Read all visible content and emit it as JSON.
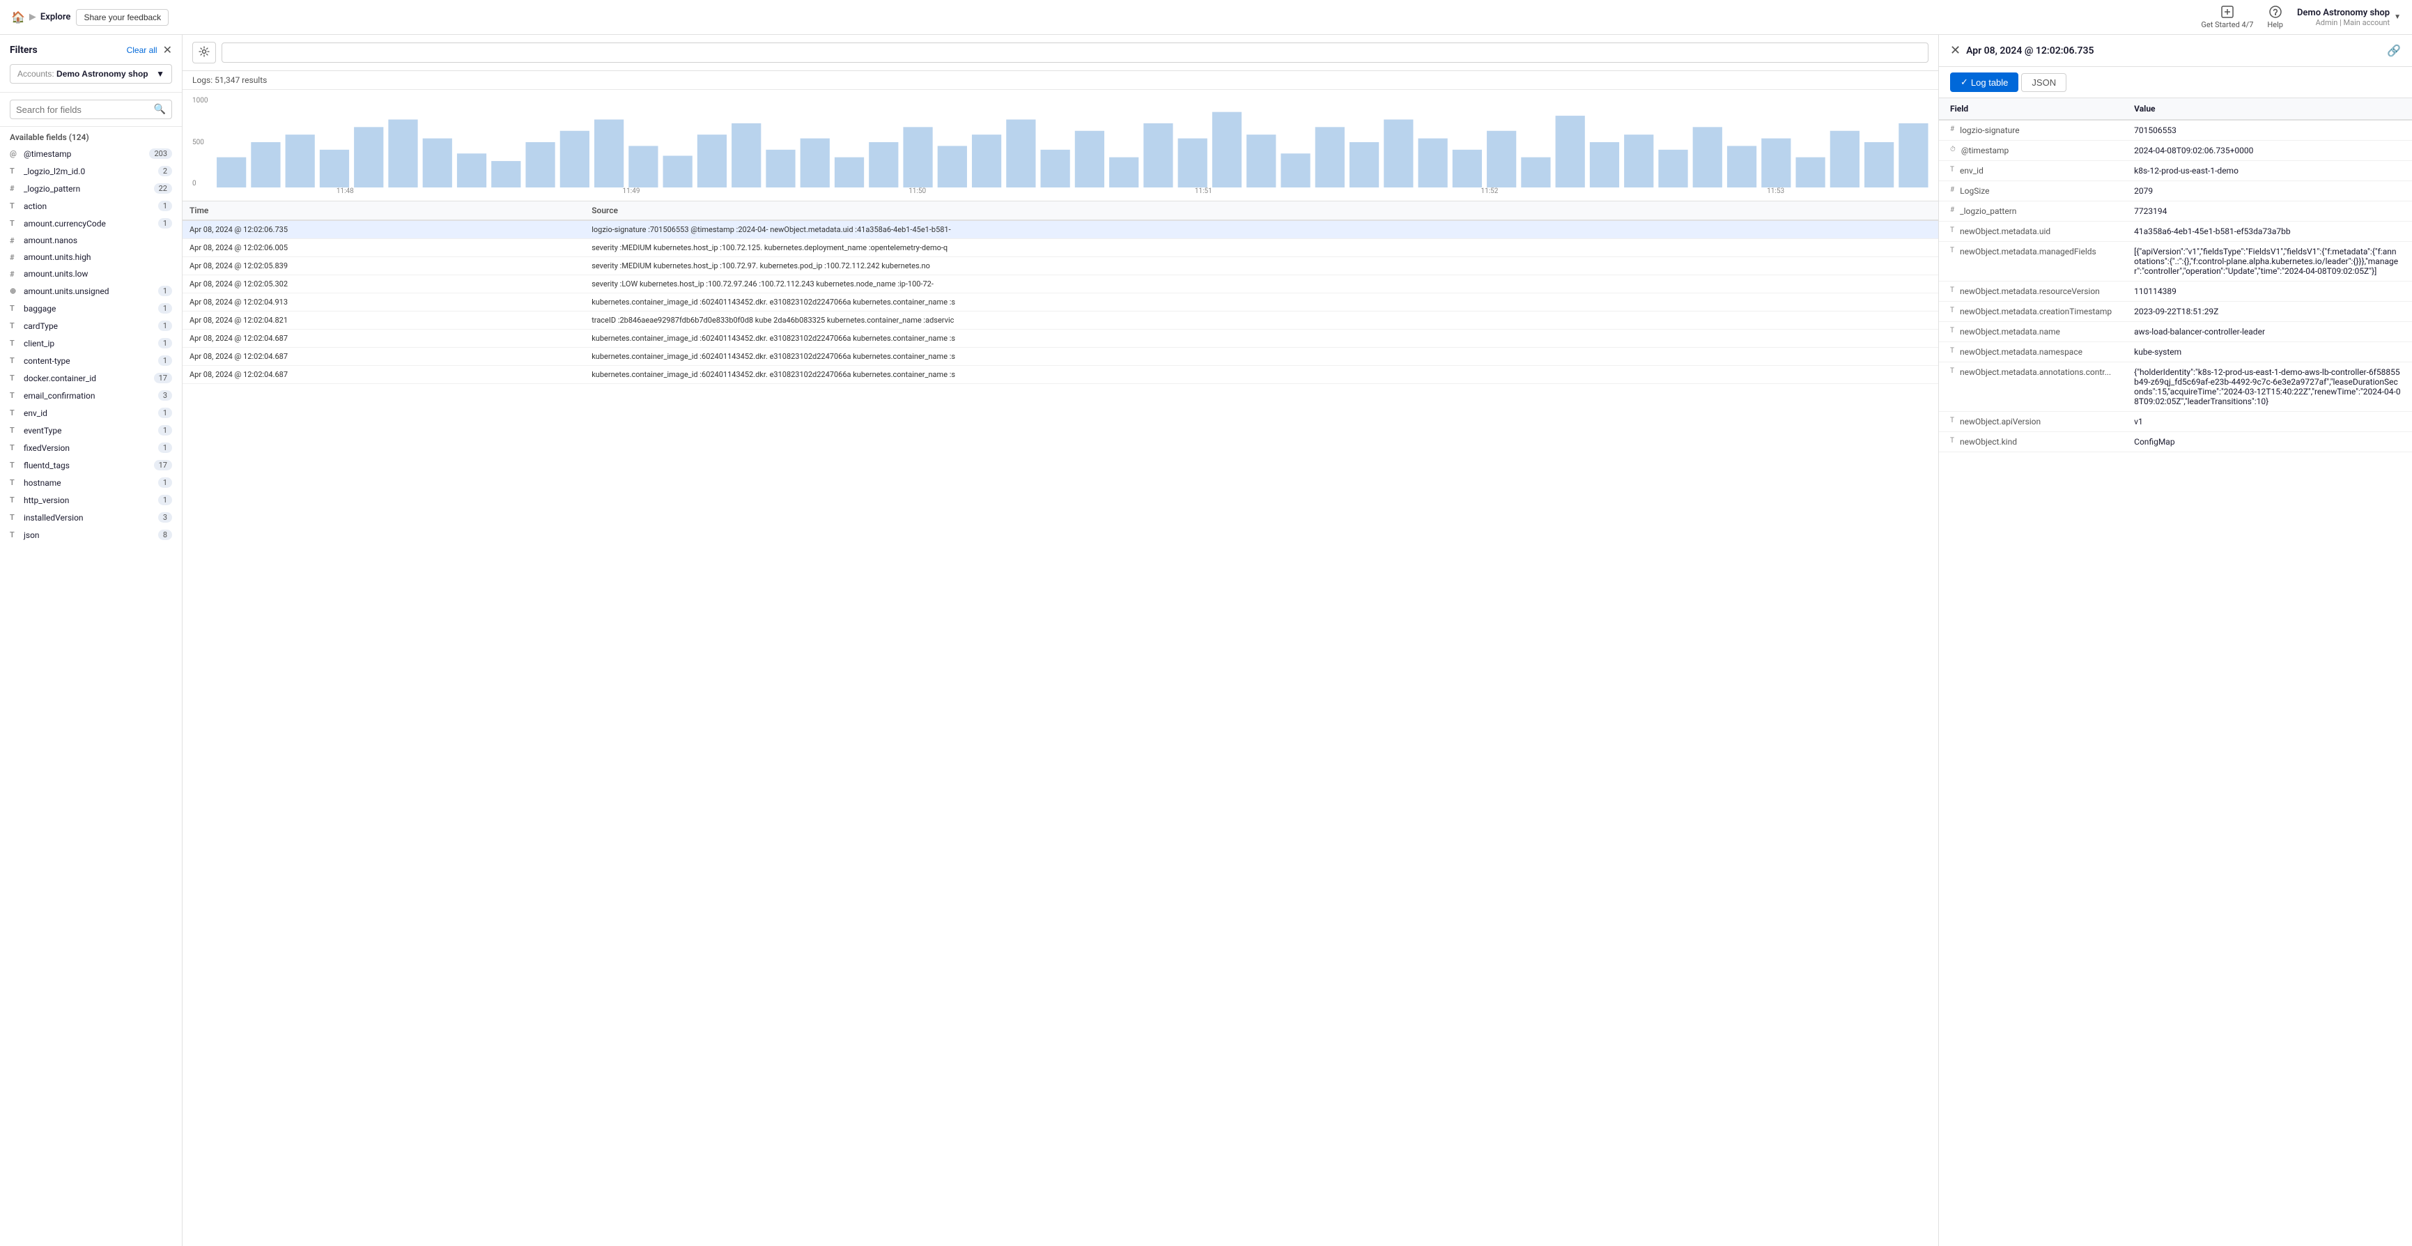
{
  "header": {
    "home_icon": "🏠",
    "breadcrumb_sep": "▶",
    "breadcrumb_current": "Explore",
    "feedback_label": "Share your feedback",
    "get_started_label": "Get Started 4/7",
    "help_label": "Help",
    "user_name": "Demo Astronomy shop",
    "user_admin": "Admin",
    "user_account": "Main account",
    "chevron": "▼"
  },
  "sidebar": {
    "filters_label": "Filters",
    "clear_all_label": "Clear all",
    "account_prefix": "Accounts:",
    "account_name": "Demo Astronomy shop",
    "search_placeholder": "Search for fields",
    "available_fields_label": "Available fields (124)",
    "fields": [
      {
        "type": "@",
        "name": "@timestamp",
        "count": 203
      },
      {
        "type": "T",
        "name": "_logzio_l2m_id.0",
        "count": 2
      },
      {
        "type": "#",
        "name": "_logzio_pattern",
        "count": 22
      },
      {
        "type": "T",
        "name": "action",
        "count": 1
      },
      {
        "type": "T",
        "name": "amount.currencyCode",
        "count": 1
      },
      {
        "type": "#",
        "name": "amount.nanos",
        "count": null
      },
      {
        "type": "#",
        "name": "amount.units.high",
        "count": null
      },
      {
        "type": "#",
        "name": "amount.units.low",
        "count": null
      },
      {
        "type": "⊕",
        "name": "amount.units.unsigned",
        "count": 1
      },
      {
        "type": "T",
        "name": "baggage",
        "count": 1
      },
      {
        "type": "T",
        "name": "cardType",
        "count": 1
      },
      {
        "type": "T",
        "name": "client_ip",
        "count": 1
      },
      {
        "type": "T",
        "name": "content-type",
        "count": 1
      },
      {
        "type": "T",
        "name": "docker.container_id",
        "count": 17
      },
      {
        "type": "T",
        "name": "email_confirmation",
        "count": 3
      },
      {
        "type": "T",
        "name": "env_id",
        "count": 1
      },
      {
        "type": "T",
        "name": "eventType",
        "count": 1
      },
      {
        "type": "T",
        "name": "fixedVersion",
        "count": 1
      },
      {
        "type": "T",
        "name": "fluentd_tags",
        "count": 17
      },
      {
        "type": "T",
        "name": "hostname",
        "count": 1
      },
      {
        "type": "T",
        "name": "http_version",
        "count": 1
      },
      {
        "type": "T",
        "name": "installedVersion",
        "count": 3
      },
      {
        "type": "T",
        "name": "json",
        "count": 8
      }
    ]
  },
  "logs": {
    "count_label": "Logs: 51,347 results",
    "chart_y_labels": [
      "1000",
      "500",
      "0"
    ],
    "chart_x_labels": [
      "11:48",
      "11:49",
      "11:50",
      "11:51",
      "11:52",
      "11:53"
    ],
    "col_time": "Time",
    "col_source": "Source",
    "rows": [
      {
        "time": "Apr 08, 2024 @ 12:02:06.735",
        "source": "logzio-signature :701506553  @timestamp :2024-04-  newObject.metadata.uid :41a358a6-4eb1-45e1-b581-",
        "active": true
      },
      {
        "time": "Apr 08, 2024 @ 12:02:06.005",
        "source": "severity :MEDIUM  kubernetes.host_ip :100.72.125. kubernetes.deployment_name :opentelemetry-demo-q",
        "active": false
      },
      {
        "time": "Apr 08, 2024 @ 12:02:05.839",
        "source": "severity :MEDIUM  kubernetes.host_ip :100.72.97. kubernetes.pod_ip :100.72.112.242  kubernetes.no",
        "active": false
      },
      {
        "time": "Apr 08, 2024 @ 12:02:05.302",
        "source": "severity :LOW  kubernetes.host_ip :100.72.97.246 :100.72.112.243  kubernetes.node_name :ip-100-72-",
        "active": false
      },
      {
        "time": "Apr 08, 2024 @ 12:02:04.913",
        "source": "kubernetes.container_image_id :602401143452.dkr. e310823102d2247066a  kubernetes.container_name :s",
        "active": false
      },
      {
        "time": "Apr 08, 2024 @ 12:02:04.821",
        "source": "traceID :2b846aeae92987fdb6b7d0e833b0f0d8  kube 2da46b083325  kubernetes.container_name :adservic",
        "active": false
      },
      {
        "time": "Apr 08, 2024 @ 12:02:04.687",
        "source": "kubernetes.container_image_id :602401143452.dkr. e310823102d2247066a  kubernetes.container_name :s",
        "active": false
      },
      {
        "time": "Apr 08, 2024 @ 12:02:04.687",
        "source": "kubernetes.container_image_id :602401143452.dkr. e310823102d2247066a  kubernetes.container_name :s",
        "active": false
      },
      {
        "time": "Apr 08, 2024 @ 12:02:04.687",
        "source": "kubernetes.container_image_id :602401143452.dkr. e310823102d2247066a  kubernetes.container_name :s",
        "active": false
      }
    ]
  },
  "detail": {
    "timestamp": "Apr 08, 2024 @ 12:02:06.735",
    "tab_log_table": "Log table",
    "tab_json": "JSON",
    "col_field": "Field",
    "col_value": "Value",
    "fields": [
      {
        "icon": "#",
        "field": "logzio-signature",
        "value": "701506553"
      },
      {
        "icon": "⏱",
        "field": "@timestamp",
        "value": "2024-04-08T09:02:06.735+0000"
      },
      {
        "icon": "T",
        "field": "env_id",
        "value": "k8s-12-prod-us-east-1-demo"
      },
      {
        "icon": "#",
        "field": "LogSize",
        "value": "2079"
      },
      {
        "icon": "#",
        "field": "_logzio_pattern",
        "value": "7723194"
      },
      {
        "icon": "T",
        "field": "newObject.metadata.uid",
        "value": "41a358a6-4eb1-45e1-b581-ef53da73a7bb"
      },
      {
        "icon": "T",
        "field": "newObject.metadata.managedFields",
        "value": "[{\"apiVersion\":\"v1\",\"fieldsType\":\"FieldsV1\",\"fieldsV1\":{\"f:metadata\":{\"f:annotations\":{\".:\":{},\"f:control-plane.alpha.kubernetes.io/leader\":{}}},\"manager\":\"controller\",\"operation\":\"Update\",\"time\":\"2024-04-08T09:02:05Z\"}]"
      },
      {
        "icon": "T",
        "field": "newObject.metadata.resourceVersion",
        "value": "110114389"
      },
      {
        "icon": "T",
        "field": "newObject.metadata.creationTimestamp",
        "value": "2023-09-22T18:51:29Z"
      },
      {
        "icon": "T",
        "field": "newObject.metadata.name",
        "value": "aws-load-balancer-controller-leader"
      },
      {
        "icon": "T",
        "field": "newObject.metadata.namespace",
        "value": "kube-system"
      },
      {
        "icon": "T",
        "field": "newObject.metadata.annotations.contr...",
        "value": "{\"holderIdentity\":\"k8s-12-prod-us-east-1-demo-aws-lb-controller-6f58855b49-z69qj_fd5c69af-e23b-4492-9c7c-6e3e2a9727af\",\"leaseDurationSeconds\":15,\"acquireTime\":\"2024-03-12T15:40:22Z\",\"renewTime\":\"2024-04-08T09:02:05Z\",\"leaderTransitions\":10}"
      },
      {
        "icon": "T",
        "field": "newObject.apiVersion",
        "value": "v1"
      },
      {
        "icon": "T",
        "field": "newObject.kind",
        "value": "ConfigMap"
      }
    ]
  }
}
